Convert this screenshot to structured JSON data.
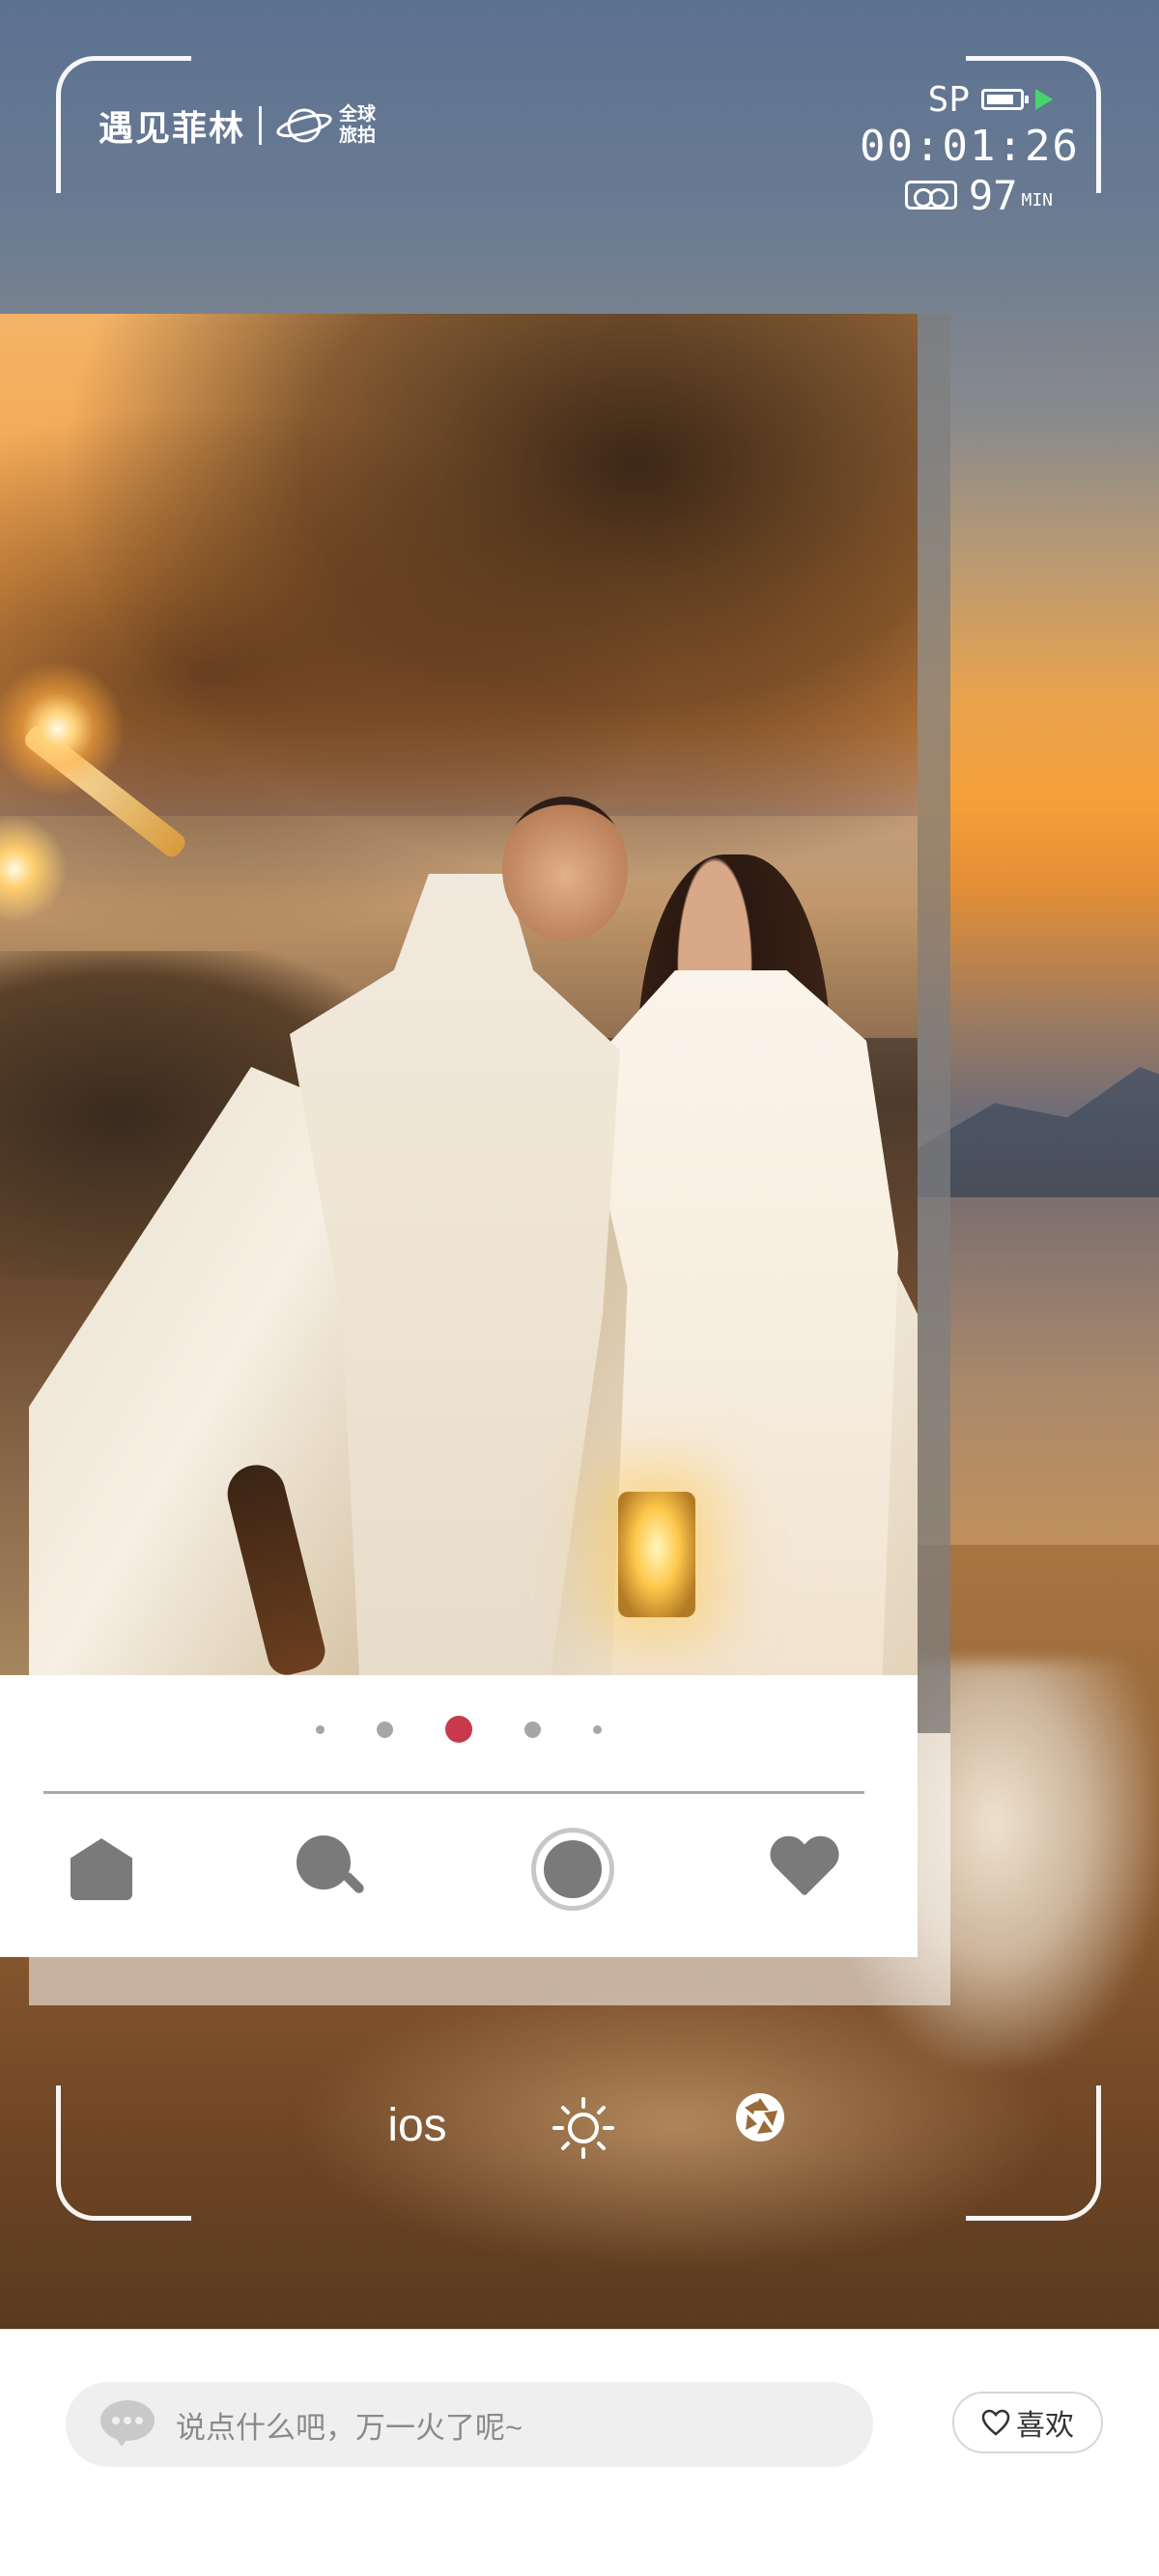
{
  "app": {
    "brand": "遇见菲林",
    "brand_sub": "全球旅拍"
  },
  "hud": {
    "mode": "SP",
    "timecode": "00:01:26",
    "remaining": "97",
    "remaining_unit": "MIN",
    "icons": [
      "battery-icon",
      "play-icon",
      "tape-icon"
    ]
  },
  "carousel": {
    "page_count": 5,
    "active_index": 2,
    "active_color": "#c8394b"
  },
  "tabbar": {
    "items": [
      "home-icon",
      "search-icon",
      "shutter-icon",
      "heart-icon"
    ]
  },
  "controls": {
    "mode_label": "ios",
    "icons": [
      "sun-icon",
      "aperture-icon"
    ]
  },
  "comment_bar": {
    "placeholder": "说点什么吧，万一火了呢~",
    "like_label": "喜欢"
  }
}
